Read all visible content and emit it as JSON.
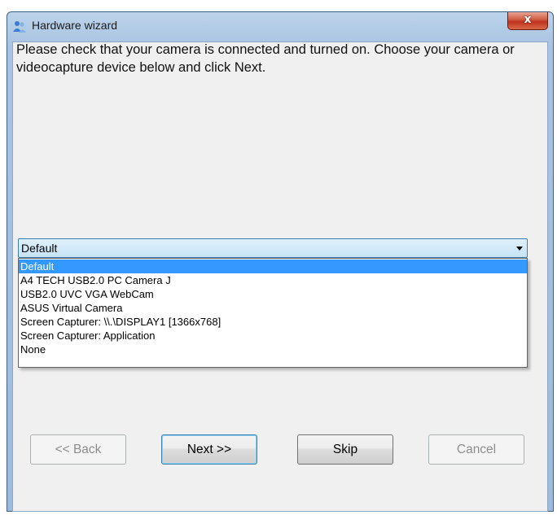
{
  "window": {
    "title": "Hardware wizard",
    "close_label": "x"
  },
  "instructions": "Please check that your camera is connected and turned on.  Choose your camera or videocapture device below and click Next.",
  "device_combo": {
    "selected": "Default",
    "options": [
      "Default",
      "A4 TECH USB2.0 PC Camera J",
      "USB2.0 UVC VGA WebCam",
      "ASUS Virtual Camera",
      "Screen Capturer: \\\\.\\DISPLAY1 [1366x768]",
      "Screen Capturer: Application",
      "None"
    ],
    "highlighted_index": 0
  },
  "buttons": {
    "back": "<< Back",
    "next": "Next >>",
    "skip": "Skip",
    "cancel": "Cancel"
  },
  "colors": {
    "selection": "#3399ff",
    "frame": "#a9c4e2",
    "close": "#c0321d"
  }
}
